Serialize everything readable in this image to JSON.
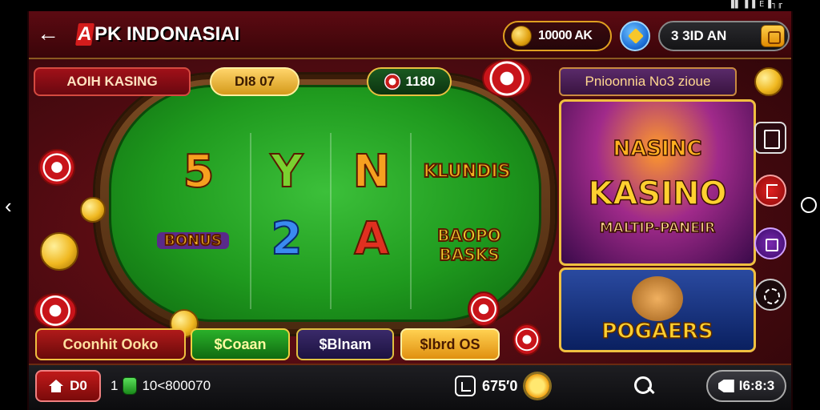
{
  "status_bar": {
    "text": "▐▌▐ ▌Е▐┐╓"
  },
  "header": {
    "back_label": "←",
    "logo_mark": "A",
    "logo_text": "PK INDONASIAI",
    "coins": "10000 AK",
    "time": "3 3ID AN"
  },
  "table": {
    "title": "AOIH KASING",
    "level": "DI8 07",
    "chips": "1180",
    "reels": [
      {
        "symbol": "5",
        "color": "#f6a020"
      },
      {
        "symbol": "Y",
        "color": "#7ad030"
      },
      {
        "symbol": "N",
        "color": "#f6a020"
      },
      {
        "symbol": "KLUNDIS",
        "color": "#f0b020"
      },
      {
        "symbol": "BONUS",
        "color": "#f0b020"
      },
      {
        "symbol": "2",
        "color": "#3a8af0"
      },
      {
        "symbol": "A",
        "color": "#e03020"
      },
      {
        "symbol": "BAOPO BASKS",
        "color": "#f0d030"
      }
    ]
  },
  "buttons": {
    "coinhit": "Coonhit Ooko",
    "ocean": "$Coaan",
    "blnam": "$Blnam",
    "bredos": "$lbrd OS"
  },
  "promo": {
    "title": "Pnioonnia No3 zioue",
    "card1_top": "NASINC",
    "card1_main": "KASINO",
    "card1_sub": "MALTIP-PANEIR",
    "card2_word": "POGAERS"
  },
  "bottom": {
    "home_label": "D0",
    "balance_prefix": "1",
    "balance_value": "10<800070",
    "stat_value": "675′0",
    "shop_label": "I6:8:3"
  },
  "colors": {
    "background": "#4a0a10",
    "felt": "#1f9a1e",
    "accent_gold": "#f0c040"
  }
}
